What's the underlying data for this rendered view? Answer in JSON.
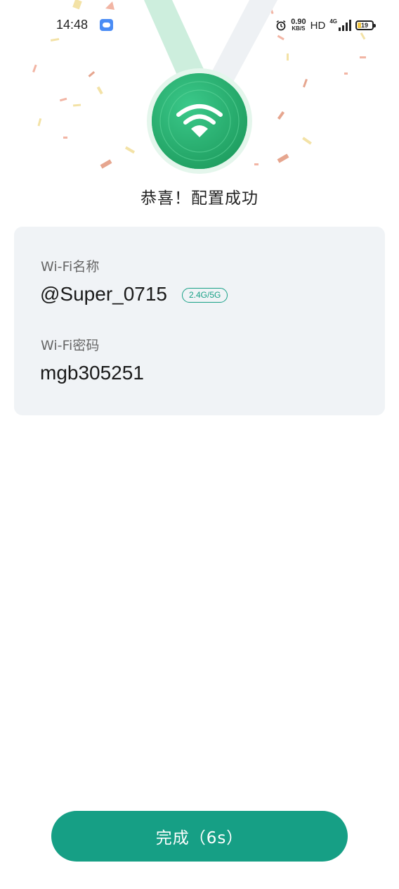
{
  "status_bar": {
    "time": "14:48",
    "net_speed_value": "0.90",
    "net_speed_unit": "KB/S",
    "hd_label": "HD",
    "network_type": "4G",
    "battery_level": "19"
  },
  "success": {
    "title": "恭喜！配置成功"
  },
  "wifi_card": {
    "name_label": "Wi-Fi名称",
    "name_value": "@Super_0715",
    "band_tag": "2.4G/5G",
    "password_label": "Wi-Fi密码",
    "password_value": "mgb305251"
  },
  "footer": {
    "done_button_label": "完成（6s）"
  },
  "colors": {
    "accent": "#169f85",
    "medal_green": "#2dba78",
    "card_bg": "#f0f3f6"
  },
  "icons": [
    "alarm-icon",
    "signal-icon",
    "battery-icon",
    "wifi-icon",
    "app-notification-icon"
  ]
}
